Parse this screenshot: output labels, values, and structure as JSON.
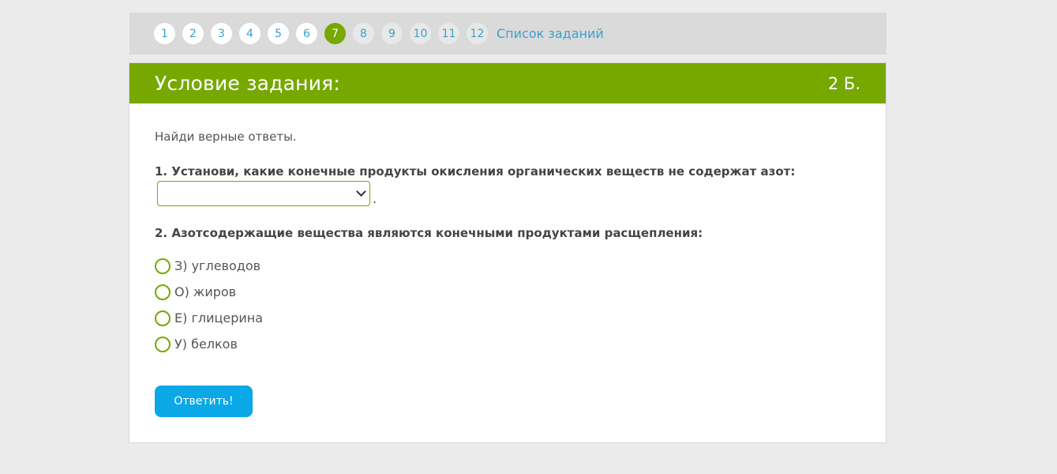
{
  "pager": {
    "items": [
      {
        "label": "1",
        "state": "visited"
      },
      {
        "label": "2",
        "state": "visited"
      },
      {
        "label": "3",
        "state": "visited"
      },
      {
        "label": "4",
        "state": "visited"
      },
      {
        "label": "5",
        "state": "visited"
      },
      {
        "label": "6",
        "state": "visited"
      },
      {
        "label": "7",
        "state": "current"
      },
      {
        "label": "8",
        "state": "future"
      },
      {
        "label": "9",
        "state": "future"
      },
      {
        "label": "10",
        "state": "future"
      },
      {
        "label": "11",
        "state": "future"
      },
      {
        "label": "12",
        "state": "future"
      }
    ],
    "task_list_link": "Список заданий"
  },
  "task": {
    "header_title": "Условие задания:",
    "points": "2 Б.",
    "intro": "Найди верные ответы.",
    "question1": "1. Установи, какие конечные продукты окисления органических веществ не содержат азот:",
    "question1_select_value": "",
    "question1_suffix": ".",
    "question2": "2. Азотсодержащие вещества являются конечными продуктами расщепления:",
    "options": [
      {
        "label": "З) углеводов"
      },
      {
        "label": "О) жиров"
      },
      {
        "label": "Е) глицерина"
      },
      {
        "label": "У) белков"
      }
    ],
    "submit_label": "Ответить!"
  },
  "colors": {
    "accent_green": "#76a800",
    "button_blue": "#0aa8e6",
    "link_blue": "#3d9fd0"
  }
}
